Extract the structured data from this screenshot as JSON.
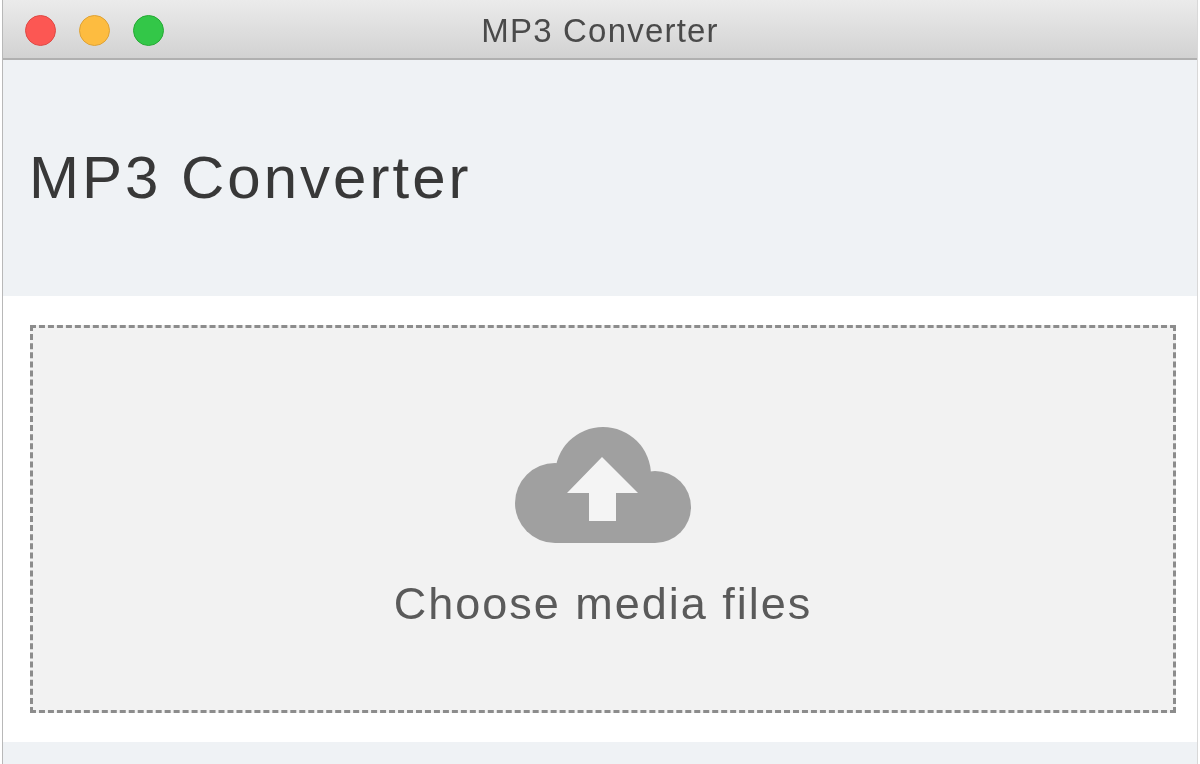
{
  "window": {
    "title": "MP3 Converter"
  },
  "header": {
    "title": "MP3 Converter"
  },
  "drop_zone": {
    "label": "Choose media files"
  }
}
